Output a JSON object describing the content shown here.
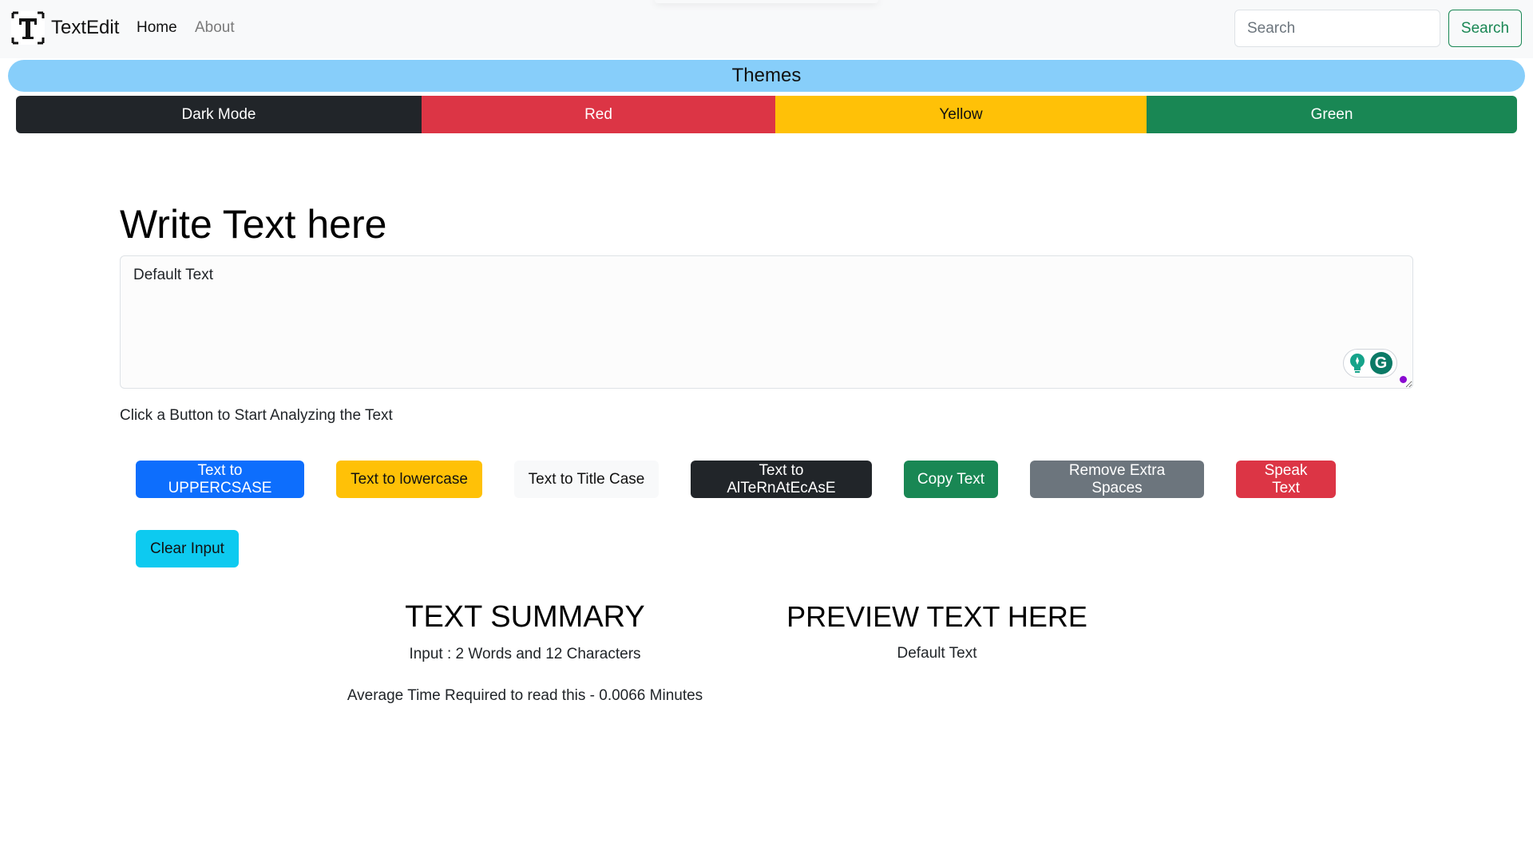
{
  "navbar": {
    "brand": "TextEdit",
    "links": [
      {
        "label": "Home",
        "active": true
      },
      {
        "label": "About",
        "active": false
      }
    ],
    "search": {
      "placeholder": "Search",
      "button_label": "Search"
    }
  },
  "themes": {
    "title": "Themes",
    "options": [
      {
        "label": "Dark Mode",
        "color": "#212529"
      },
      {
        "label": "Red",
        "color": "#dc3545"
      },
      {
        "label": "Yellow",
        "color": "#ffc107"
      },
      {
        "label": "Green",
        "color": "#198754"
      }
    ]
  },
  "editor": {
    "heading": "Write Text here",
    "textarea_value": "Default Text",
    "hint": "Click a Button to Start Analyzing the Text",
    "grammarly_letter": "G"
  },
  "actions": [
    {
      "label": "Text to UPPERCSASE",
      "color": "#0d6efd"
    },
    {
      "label": "Text to lowercase",
      "color": "#ffc107"
    },
    {
      "label": "Text to Title Case",
      "color": "#f8f9fa"
    },
    {
      "label": "Text to AlTeRnAtEcAsE",
      "color": "#212529"
    },
    {
      "label": "Copy Text",
      "color": "#198754"
    },
    {
      "label": "Remove Extra Spaces",
      "color": "#6c757d"
    },
    {
      "label": "Speak Text",
      "color": "#dc3545"
    },
    {
      "label": "Clear Input",
      "color": "#0dcaf0"
    }
  ],
  "summary": {
    "title": "TEXT SUMMARY",
    "counts": "Input : 2 Words and 12 Characters",
    "read_time": "Average Time Required to read this - 0.0066 Minutes"
  },
  "preview": {
    "title": "PREVIEW TEXT HERE",
    "text": "Default Text"
  }
}
